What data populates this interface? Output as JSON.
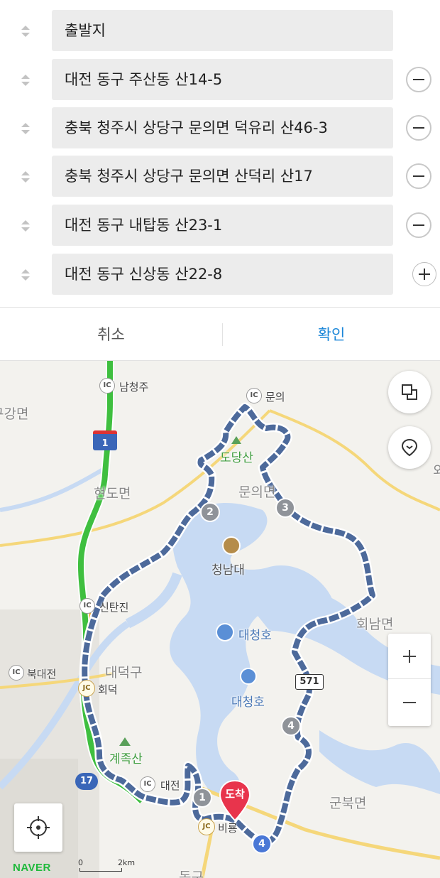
{
  "route": {
    "origin": {
      "placeholder": "출발지"
    },
    "waypoints": [
      {
        "value": "대전 동구 주산동 산14-5"
      },
      {
        "value": "충북 청주시 상당구 문의면 덕유리 산46-3"
      },
      {
        "value": "충북 청주시 상당구 문의면 산덕리 산17"
      },
      {
        "value": "대전 동구 내탑동 산23-1"
      }
    ],
    "destination": {
      "value": "대전 동구 신상동 산22-8"
    }
  },
  "actions": {
    "cancel_label": "취소",
    "confirm_label": "확인"
  },
  "colors": {
    "accent": "#1a86d8",
    "route": "#4d6a9b",
    "highway": "#3fbf3f",
    "arrival_marker": "#e8344c",
    "water": "#c7daf3"
  },
  "map": {
    "labels": {
      "namcheongju": "남청주",
      "munui": "문의",
      "gugangmyeon": "구강면",
      "dodangsan": "도당산",
      "hyeondomyeon": "현도면",
      "munuimyeon": "문의면",
      "cheongnamdae": "청남대",
      "sintanjin": "신탄진",
      "daecheongho_1": "대청호",
      "hoenammyeon": "회남면",
      "bukdaejeon": "북대전",
      "daedeokgu": "대덕구",
      "hoedeok": "회덕",
      "daecheongho_2": "대청호",
      "gyejoksan": "계족산",
      "daejeon_ic": "대전",
      "gunbukmyeon": "군북면",
      "birae": "비룡",
      "dong_gu": "동구",
      "right_edge": "외인"
    },
    "badges": {
      "ic": "IC",
      "jc": "JC"
    },
    "road_shields": {
      "highway_1": "1",
      "route_17": "17",
      "route_571": "571"
    },
    "waypoint_markers": [
      "1",
      "2",
      "3",
      "4",
      "4"
    ],
    "arrival_marker_label": "도착",
    "brand": "NAVER",
    "scale": {
      "zero": "0",
      "max": "2km"
    },
    "icons": [
      "layers-icon",
      "location-pin-icon",
      "zoom-in-icon",
      "zoom-out-icon",
      "crosshair-icon"
    ]
  }
}
